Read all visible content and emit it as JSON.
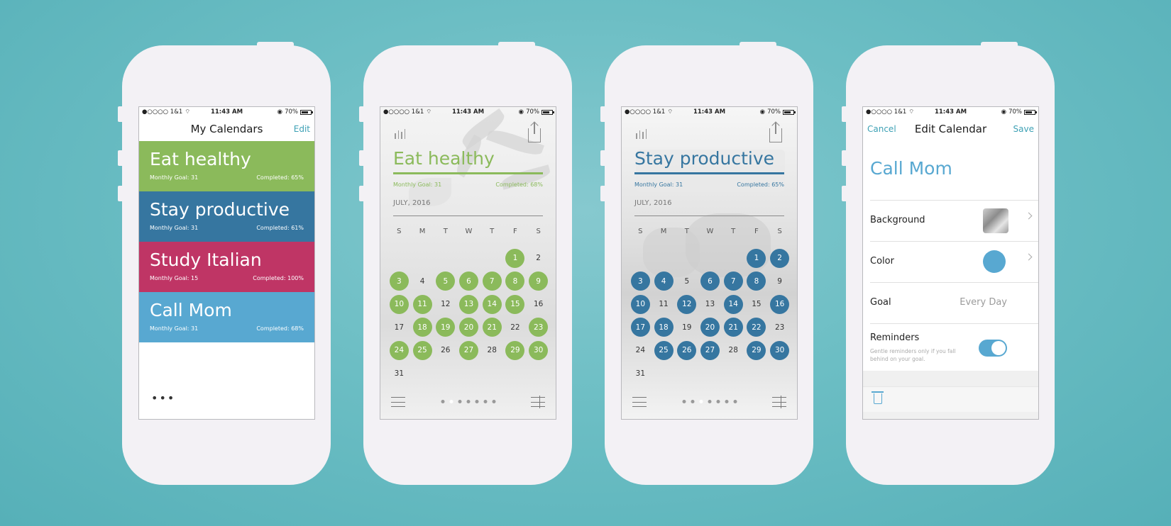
{
  "status_bar": {
    "carrier": "●○○○○ 1&1",
    "time": "11:43 AM",
    "battery": "70%"
  },
  "colors": {
    "green": "#8bba5b",
    "blue_dark": "#3676a0",
    "pink": "#bf3565",
    "blue_light": "#58a8d1",
    "accent": "#3ea1b5"
  },
  "screen1": {
    "title": "My Calendars",
    "edit_label": "Edit",
    "more_label": "•••",
    "calendars": [
      {
        "name": "Eat healthy",
        "goal": "Monthly Goal: 31",
        "completed": "Completed: 65%"
      },
      {
        "name": "Stay productive",
        "goal": "Monthly Goal: 31",
        "completed": "Completed: 61%"
      },
      {
        "name": "Study Italian",
        "goal": "Monthly Goal: 15",
        "completed": "Completed: 100%"
      },
      {
        "name": "Call Mom",
        "goal": "Monthly Goal: 31",
        "completed": "Completed: 68%"
      }
    ]
  },
  "screen2": {
    "title": "Eat healthy",
    "goal": "Monthly Goal: 31",
    "completed": "Completed: 68%",
    "month": "JULY, 2016",
    "weekdays": [
      "S",
      "M",
      "T",
      "W",
      "T",
      "F",
      "S"
    ],
    "first_weekday_index": 5,
    "days_in_month": 31,
    "completed_days": [
      1,
      3,
      5,
      6,
      7,
      8,
      9,
      10,
      11,
      13,
      14,
      15,
      18,
      19,
      20,
      21,
      23,
      24,
      25,
      27,
      29,
      30
    ],
    "current_page": 1,
    "page_count": 7
  },
  "screen3": {
    "title": "Stay productive",
    "goal": "Monthly Goal: 31",
    "completed": "Completed: 65%",
    "month": "JULY, 2016",
    "weekdays": [
      "S",
      "M",
      "T",
      "W",
      "T",
      "F",
      "S"
    ],
    "first_weekday_index": 5,
    "days_in_month": 31,
    "completed_days": [
      1,
      2,
      3,
      4,
      6,
      7,
      8,
      10,
      12,
      14,
      16,
      17,
      18,
      20,
      21,
      22,
      25,
      26,
      27,
      29,
      30
    ],
    "current_page": 2,
    "page_count": 7
  },
  "screen4": {
    "cancel_label": "Cancel",
    "title": "Edit Calendar",
    "save_label": "Save",
    "calendar_name": "Call Mom",
    "background_label": "Background",
    "color_label": "Color",
    "goal_label": "Goal",
    "goal_value": "Every Day",
    "reminders_label": "Reminders",
    "reminders_sub": "Gentle reminders only if you fall behind on your goal.",
    "reminders_on": true
  }
}
